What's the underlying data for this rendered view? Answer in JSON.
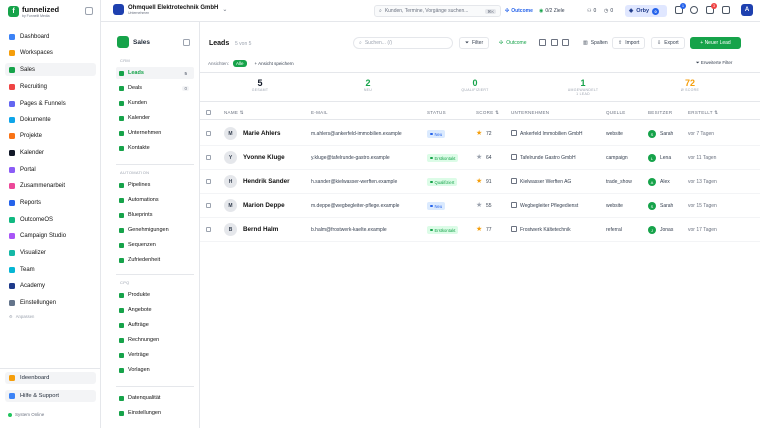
{
  "brand": {
    "name": "funnelized",
    "tagline": "by Funnelit Media"
  },
  "sidebar": {
    "items": [
      {
        "label": "Dashboard",
        "color": "#3b82f6"
      },
      {
        "label": "Workspaces",
        "color": "#f59e0b"
      },
      {
        "label": "Sales",
        "color": "#16a34a"
      },
      {
        "label": "Recruiting",
        "color": "#ef4444"
      },
      {
        "label": "Pages & Funnels",
        "color": "#6366f1"
      },
      {
        "label": "Dokumente",
        "color": "#0ea5e9"
      },
      {
        "label": "Projekte",
        "color": "#f97316"
      },
      {
        "label": "Kalender",
        "color": "#111827"
      },
      {
        "label": "Portal",
        "color": "#8b5cf6"
      },
      {
        "label": "Zusammenarbeit",
        "color": "#ec4899"
      },
      {
        "label": "Reports",
        "color": "#2563eb"
      },
      {
        "label": "OutcomeOS",
        "color": "#10b981"
      },
      {
        "label": "Campaign Studio",
        "color": "#a855f7"
      },
      {
        "label": "Visualizer",
        "color": "#14b8a6"
      },
      {
        "label": "Team",
        "color": "#06b6d4"
      },
      {
        "label": "Academy",
        "color": "#1e3a8a"
      },
      {
        "label": "Einstellungen",
        "color": "#64748b"
      }
    ],
    "small_link": "Anpassen",
    "ideenboard": "Ideenboard",
    "help": "Hilfe & Support",
    "status": "System Online"
  },
  "topbar": {
    "company_name": "Ohmquell Elektrotechnik GmbH",
    "company_sub": "Unternehmen",
    "search_placeholder": "Kunden, Termine, Vorgänge suchen...",
    "search_kbd": "⌘K",
    "outcome_label": "Outcome",
    "goals_label": "0/2 Ziele",
    "count1": "0",
    "count2": "0",
    "orby_label": "Orby",
    "orby_badge": "0",
    "bell_badge": "3",
    "avatar_initial": "A"
  },
  "sales_panel": {
    "title": "Sales",
    "sections": [
      {
        "label": "CRM",
        "items": [
          {
            "label": "Leads",
            "count": "5",
            "active": true
          },
          {
            "label": "Deals",
            "count": "0"
          },
          {
            "label": "Kunden"
          },
          {
            "label": "Kalender"
          },
          {
            "label": "Unternehmen"
          },
          {
            "label": "Kontakte"
          }
        ]
      },
      {
        "label": "AUTOMATION",
        "items": [
          {
            "label": "Pipelines"
          },
          {
            "label": "Automations"
          },
          {
            "label": "Blueprints"
          },
          {
            "label": "Genehmigungen"
          },
          {
            "label": "Sequenzen"
          },
          {
            "label": "Zufriedenheit"
          }
        ]
      },
      {
        "label": "CPQ",
        "items": [
          {
            "label": "Produkte"
          },
          {
            "label": "Angebote"
          },
          {
            "label": "Aufträge"
          },
          {
            "label": "Rechnungen"
          },
          {
            "label": "Verträge"
          },
          {
            "label": "Vorlagen"
          }
        ]
      }
    ],
    "footer_items": [
      {
        "label": "Datenqualität"
      },
      {
        "label": "Einstellungen"
      }
    ]
  },
  "main": {
    "title": "Leads",
    "subtitle": "5 von 5",
    "search_placeholder": "Suchen... (/)",
    "filter_btn": "Filter",
    "outcome_btn": "Outcome",
    "columns_btn": "Spalten",
    "import_btn": "Import",
    "export_btn": "Export",
    "new_lead_btn": "+ Neuer Lead",
    "views_label": "Ansichten:",
    "view_all": "Alle",
    "save_view": "+ Ansicht speichern",
    "adv_filter": "Erweiterte Filter",
    "stats": [
      {
        "value": "5",
        "label": "GESAMT",
        "color": "#111827"
      },
      {
        "value": "2",
        "label": "NEU",
        "color": "#16a34a"
      },
      {
        "value": "0",
        "label": "QUALIFIZIERT",
        "color": "#16a34a"
      },
      {
        "value": "1",
        "label": "UMGEWANDELT",
        "sub": "1 LEAD",
        "color": "#16a34a"
      },
      {
        "value": "72",
        "label": "Ø SCORE",
        "color": "#f59e0b"
      }
    ],
    "columns": [
      "NAME",
      "E-MAIL",
      "STATUS",
      "SCORE",
      "UNTERNEHMEN",
      "QUELLE",
      "BESITZER",
      "ERSTELLT"
    ],
    "rows": [
      {
        "initial": "M",
        "name": "Marie Ahlers",
        "email": "m.ahlers@ankerfeld-immobilien.example",
        "status": "Neu",
        "status_color": "#2563eb",
        "status_bg": "#dbeafe",
        "score": "72",
        "star_color": "#f59e0b",
        "company": "Ankerfeld Immobilien GmbH",
        "source": "website",
        "owner_initial": "S",
        "owner": "Sarah",
        "owner_color": "#16a34a",
        "created": "vor 7 Tagen"
      },
      {
        "initial": "Y",
        "name": "Yvonne Kluge",
        "email": "y.kluge@tafelrunde-gastro.example",
        "status": "Erstkontakt",
        "status_color": "#16a34a",
        "status_bg": "#dcfce7",
        "score": "64",
        "star_color": "#9ca3af",
        "company": "Tafelrunde Gastro GmbH",
        "source": "campaign",
        "owner_initial": "L",
        "owner": "Lena",
        "owner_color": "#16a34a",
        "created": "vor 11 Tagen"
      },
      {
        "initial": "H",
        "name": "Hendrik Sander",
        "email": "h.sander@kielwasser-werften.example",
        "status": "Qualifiziert",
        "status_color": "#16a34a",
        "status_bg": "#dcfce7",
        "score": "91",
        "star_color": "#f59e0b",
        "company": "Kielwasser Werften AG",
        "source": "trade_show",
        "owner_initial": "A",
        "owner": "Alex",
        "owner_color": "#16a34a",
        "created": "vor 13 Tagen"
      },
      {
        "initial": "M",
        "name": "Marion Deppe",
        "email": "m.deppe@wegbegleiter-pflege.example",
        "status": "Neu",
        "status_color": "#2563eb",
        "status_bg": "#dbeafe",
        "score": "55",
        "star_color": "#9ca3af",
        "company": "Wegbegleiter Pflegedienst",
        "source": "website",
        "owner_initial": "S",
        "owner": "Sarah",
        "owner_color": "#16a34a",
        "created": "vor 15 Tagen"
      },
      {
        "initial": "B",
        "name": "Bernd Halm",
        "email": "b.halm@frostwerk-kaelte.example",
        "status": "Erstkontakt",
        "status_color": "#16a34a",
        "status_bg": "#dcfce7",
        "score": "77",
        "star_color": "#f59e0b",
        "company": "Frostwerk Kältetechnik",
        "source": "referral",
        "owner_initial": "J",
        "owner": "Jonas",
        "owner_color": "#16a34a",
        "created": "vor 17 Tagen"
      }
    ]
  }
}
